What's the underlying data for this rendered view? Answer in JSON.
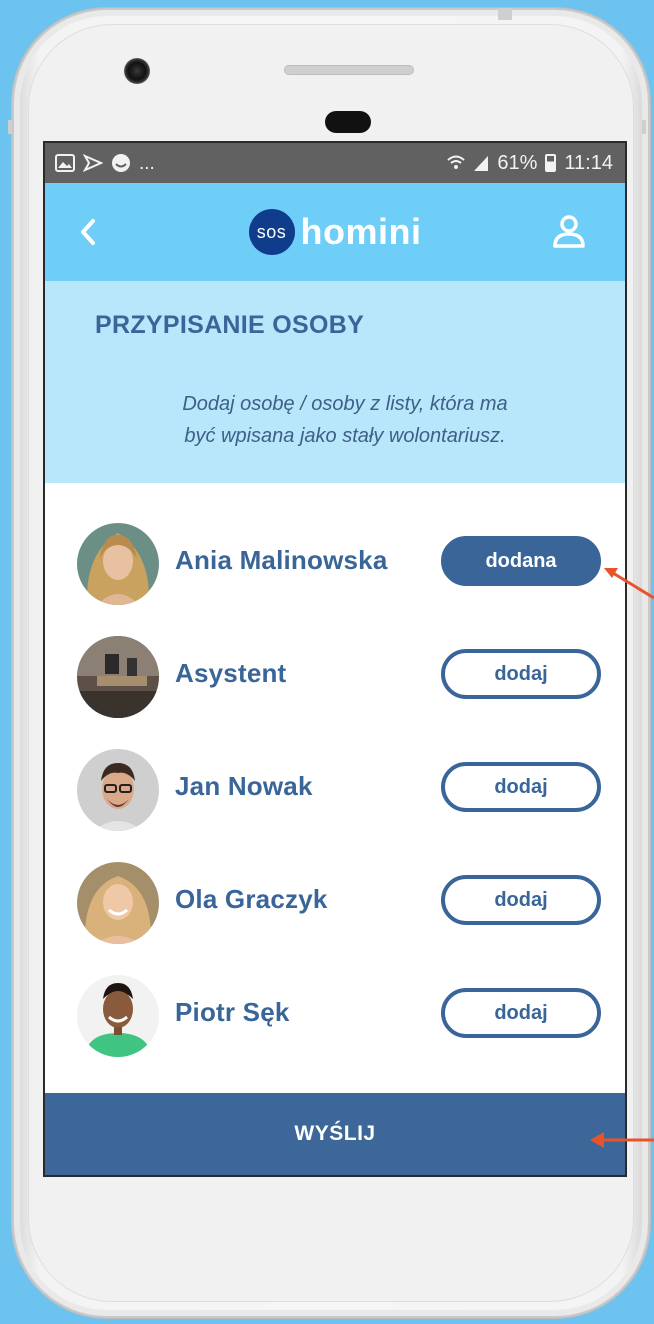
{
  "status_bar": {
    "left_icons": [
      "image-icon",
      "cast-icon",
      "emoji-icon"
    ],
    "more": "...",
    "battery": "61%",
    "time": "11:14"
  },
  "app_bar": {
    "logo_badge": "sos",
    "logo_text": "homini"
  },
  "header": {
    "title": "PRZYPISANIE OSOBY",
    "description_line1": "Dodaj osobę / osoby z listy, która ma",
    "description_line2": "być wpisana jako stały wolontariusz."
  },
  "people": [
    {
      "name": "Ania Malinowska",
      "button": "dodana",
      "added": true
    },
    {
      "name": "Asystent",
      "button": "dodaj",
      "added": false
    },
    {
      "name": "Jan Nowak",
      "button": "dodaj",
      "added": false
    },
    {
      "name": "Ola Graczyk",
      "button": "dodaj",
      "added": false
    },
    {
      "name": "Piotr Sęk",
      "button": "dodaj",
      "added": false
    }
  ],
  "send_button": "WYŚLIJ",
  "colors": {
    "background": "#6cc3ef",
    "app_bar": "#6ecef8",
    "header_panel": "#b8e6fb",
    "primary": "#3a6598",
    "annotation_arrow": "#e8542a"
  }
}
